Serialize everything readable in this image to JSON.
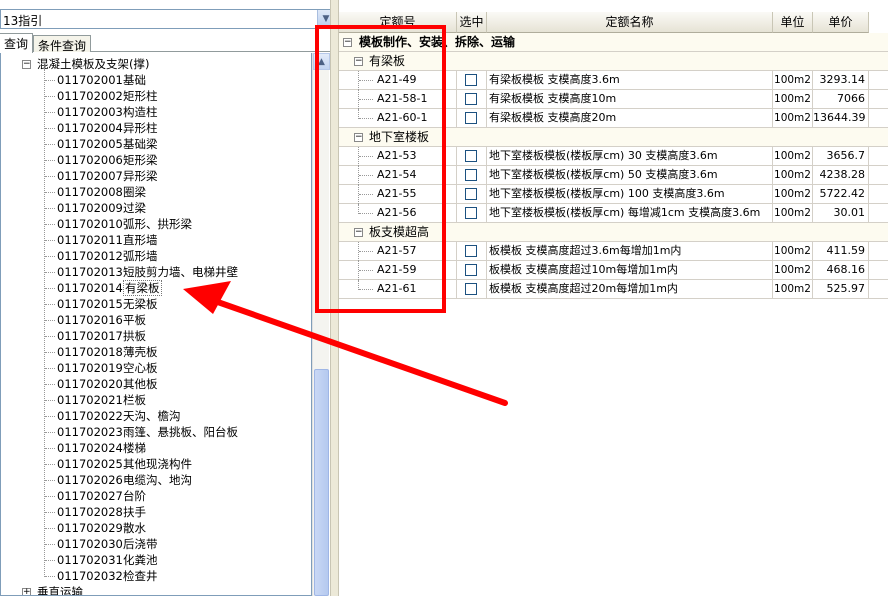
{
  "combo": {
    "value": "13指引"
  },
  "tabs": [
    {
      "label": "查询",
      "active": true
    },
    {
      "label": "条件查询",
      "active": false
    }
  ],
  "tree": {
    "parent": "混凝土模板及支架(撑)",
    "items": [
      {
        "code": "011702001",
        "label": "基础"
      },
      {
        "code": "011702002",
        "label": "矩形柱"
      },
      {
        "code": "011702003",
        "label": "构造柱"
      },
      {
        "code": "011702004",
        "label": "异形柱"
      },
      {
        "code": "011702005",
        "label": "基础梁"
      },
      {
        "code": "011702006",
        "label": "矩形梁"
      },
      {
        "code": "011702007",
        "label": "异形梁"
      },
      {
        "code": "011702008",
        "label": "圈梁"
      },
      {
        "code": "011702009",
        "label": "过梁"
      },
      {
        "code": "011702010",
        "label": "弧形、拱形梁"
      },
      {
        "code": "011702011",
        "label": "直形墙"
      },
      {
        "code": "011702012",
        "label": "弧形墙"
      },
      {
        "code": "011702013",
        "label": "短肢剪力墙、电梯井壁"
      },
      {
        "code": "011702014",
        "label": "有梁板",
        "selected": true
      },
      {
        "code": "011702015",
        "label": "无梁板"
      },
      {
        "code": "011702016",
        "label": "平板"
      },
      {
        "code": "011702017",
        "label": "拱板"
      },
      {
        "code": "011702018",
        "label": "薄壳板"
      },
      {
        "code": "011702019",
        "label": "空心板"
      },
      {
        "code": "011702020",
        "label": "其他板"
      },
      {
        "code": "011702021",
        "label": "栏板"
      },
      {
        "code": "011702022",
        "label": "天沟、檐沟"
      },
      {
        "code": "011702023",
        "label": "雨篷、悬挑板、阳台板"
      },
      {
        "code": "011702024",
        "label": "楼梯"
      },
      {
        "code": "011702025",
        "label": "其他现浇构件"
      },
      {
        "code": "011702026",
        "label": "电缆沟、地沟"
      },
      {
        "code": "011702027",
        "label": "台阶"
      },
      {
        "code": "011702028",
        "label": "扶手"
      },
      {
        "code": "011702029",
        "label": "散水"
      },
      {
        "code": "011702030",
        "label": "后浇带"
      },
      {
        "code": "011702031",
        "label": "化粪池"
      },
      {
        "code": "011702032",
        "label": "检查井"
      }
    ],
    "next_parent": "垂直运输"
  },
  "grid": {
    "headers": [
      "定额号",
      "选中",
      "定额名称",
      "单位",
      "单价"
    ],
    "group": {
      "title": "模板制作、安装、拆除、运输"
    },
    "sections": [
      {
        "title": "有梁板",
        "rows": [
          {
            "code": "A21-49",
            "name": "有梁板模板 支模高度3.6m",
            "unit": "100m2",
            "price": "3293.14"
          },
          {
            "code": "A21-58-1",
            "name": "有梁板模板 支模高度10m",
            "unit": "100m2",
            "price": "7066"
          },
          {
            "code": "A21-60-1",
            "name": "有梁板模板 支模高度20m",
            "unit": "100m2",
            "price": "13644.39"
          }
        ]
      },
      {
        "title": "地下室楼板",
        "rows": [
          {
            "code": "A21-53",
            "name": "地下室楼板模板(楼板厚cm) 30 支模高度3.6m",
            "unit": "100m2",
            "price": "3656.7"
          },
          {
            "code": "A21-54",
            "name": "地下室楼板模板(楼板厚cm) 50 支模高度3.6m",
            "unit": "100m2",
            "price": "4238.28"
          },
          {
            "code": "A21-55",
            "name": "地下室楼板模板(楼板厚cm) 100 支模高度3.6m",
            "unit": "100m2",
            "price": "5722.42"
          },
          {
            "code": "A21-56",
            "name": "地下室楼板模板(楼板厚cm) 每增减1cm 支模高度3.6m",
            "unit": "100m2",
            "price": "30.01"
          }
        ]
      },
      {
        "title": "板支模超高",
        "rows": [
          {
            "code": "A21-57",
            "name": "板模板 支模高度超过3.6m每增加1m内",
            "unit": "100m2",
            "price": "411.59"
          },
          {
            "code": "A21-59",
            "name": "板模板 支模高度超过10m每增加1m内",
            "unit": "100m2",
            "price": "468.16"
          },
          {
            "code": "A21-61",
            "name": "板模板 支模高度超过20m每增加1m内",
            "unit": "100m2",
            "price": "525.97"
          }
        ]
      }
    ]
  },
  "annotation": {
    "color": "#ff0000"
  },
  "icons": {
    "expand": "minus-box-icon",
    "collapse": "plus-box-icon",
    "dropdown": "chevron-down-icon",
    "scroll_up": "chevron-up-icon"
  }
}
